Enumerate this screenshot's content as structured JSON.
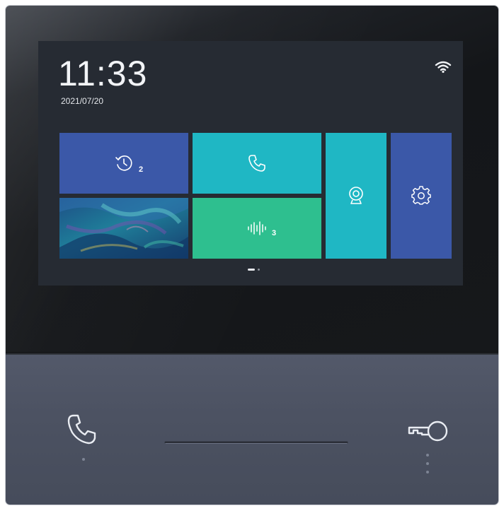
{
  "screen": {
    "time": "11:33",
    "date": "2021/07/20"
  },
  "tiles": {
    "history": {
      "icon": "history-clock-icon",
      "badge": "2"
    },
    "call": {
      "icon": "phone-icon"
    },
    "photo": {
      "icon": "wallpaper-image"
    },
    "voice": {
      "icon": "voice-message-icon",
      "badge": "3"
    },
    "monitor": {
      "icon": "camera-monitor-icon"
    },
    "settings": {
      "icon": "gear-icon"
    }
  },
  "status": {
    "wifi": "wifi-icon"
  },
  "pager": {
    "pages": 2,
    "active": 1
  },
  "colors": {
    "blue_tile": "#3b58a8",
    "cyan_tile": "#1fb7c4",
    "green_tile": "#2ebf8f",
    "screen_bg": "#262b33",
    "panel": "#4c5262"
  },
  "hardware": {
    "left_button_icon": "phone-icon",
    "right_button_icon": "key-icon"
  }
}
